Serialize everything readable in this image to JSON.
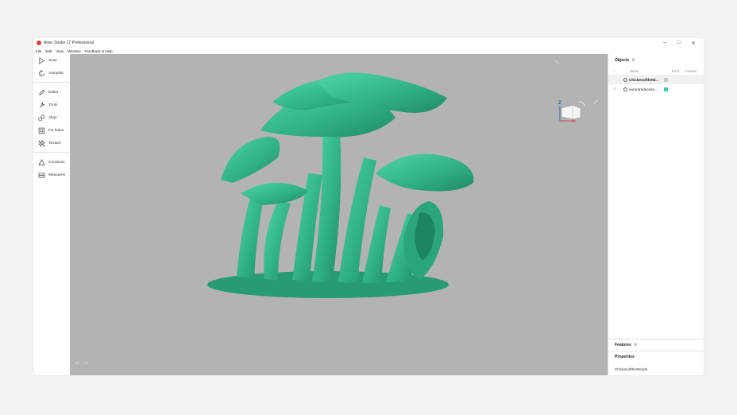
{
  "window": {
    "title": "Artec Studio 17 Professional",
    "controls": {
      "minimize": "─",
      "maximize": "□",
      "close": "✕"
    }
  },
  "menu": [
    "File",
    "Edit",
    "View",
    "Window",
    "Feedback & Help"
  ],
  "sidebar": {
    "items": [
      {
        "label": "Scan",
        "icon": "play-icon"
      },
      {
        "label": "Autopilot",
        "icon": "autopilot-icon"
      },
      {
        "label": "Editor",
        "icon": "pencil-icon"
      },
      {
        "label": "Tools",
        "icon": "wrench-icon"
      },
      {
        "label": "Align",
        "icon": "align-icon"
      },
      {
        "label": "Fix holes",
        "icon": "fix-holes-icon"
      },
      {
        "label": "Texture",
        "icon": "texture-icon"
      },
      {
        "label": "Construct",
        "icon": "triangle-icon"
      },
      {
        "label": "Measures",
        "icon": "measures-icon"
      }
    ]
  },
  "viewport": {
    "mesh_color": "#3fbf96",
    "background": "#b3b3b3",
    "view_cube": {
      "axis_z": "Z",
      "axis_x": "X"
    }
  },
  "objects": {
    "title": "Objects",
    "columns": {
      "name": "Name",
      "error": "Error",
      "frames": "Frames"
    },
    "rows": [
      {
        "name": "ChickenoftheW...",
        "checked": "",
        "swatch": "#c8c8c8",
        "selected": true
      },
      {
        "name": "aurorareducesu...",
        "checked": "✓",
        "swatch": "#3fcfa6",
        "selected": false
      }
    ]
  },
  "features": {
    "title": "Features"
  },
  "properties": {
    "title": "Properties",
    "value": "ChickenoftheWoods"
  }
}
